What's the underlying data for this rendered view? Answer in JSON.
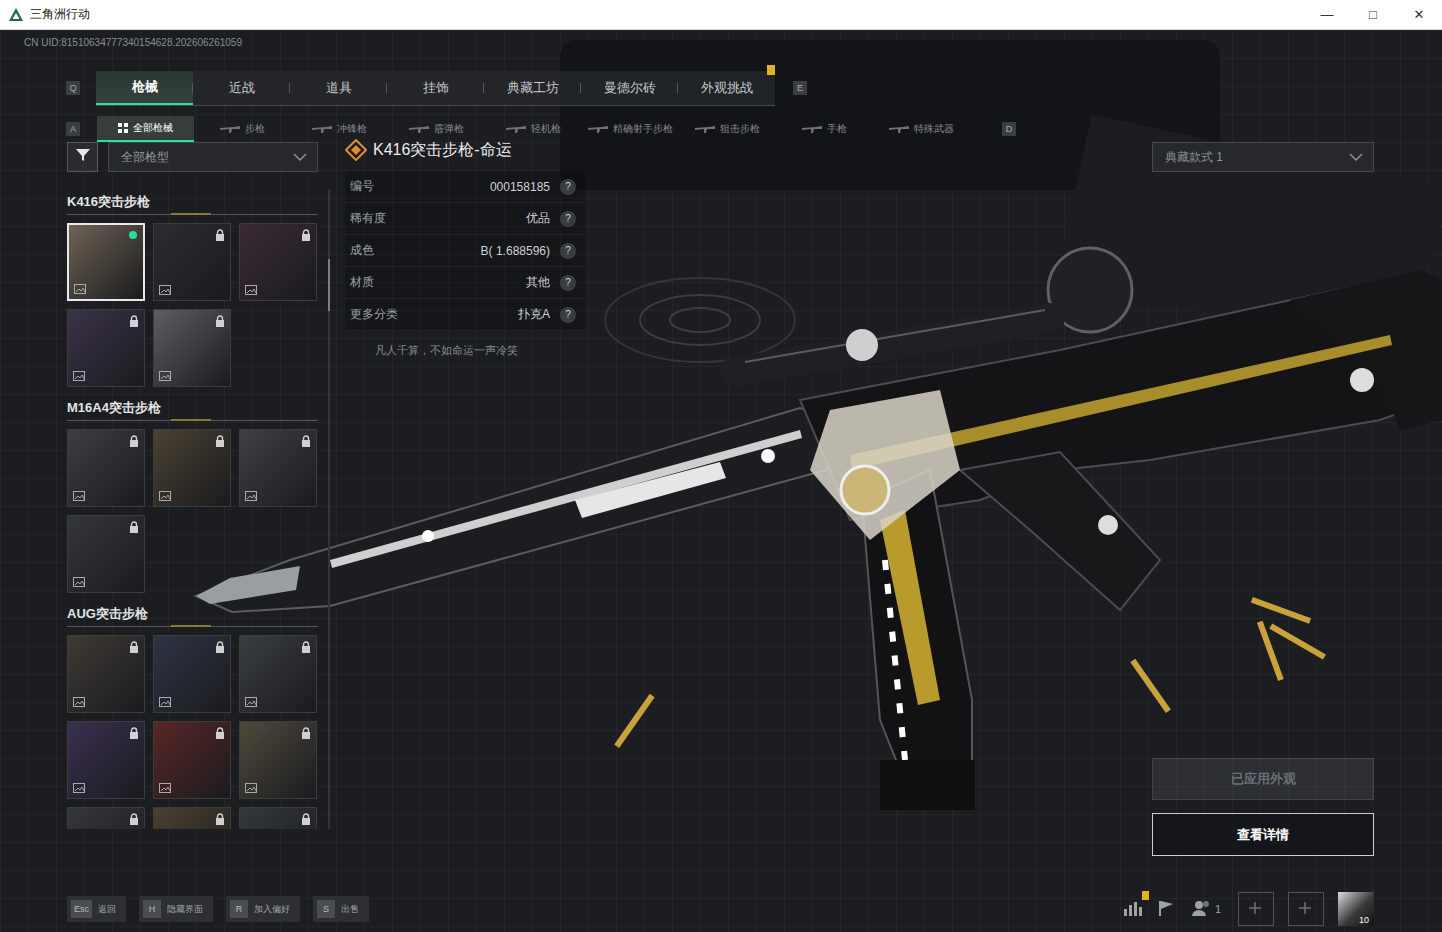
{
  "window": {
    "title": "三角洲行动",
    "controls": [
      "—",
      "□",
      "✕"
    ]
  },
  "uid": "CN UID:81510634777340154628.202606261059",
  "top_tabs": {
    "prev_key": "Q",
    "next_key": "E",
    "items": [
      {
        "label": "枪械",
        "selected": true,
        "badge": false
      },
      {
        "label": "近战",
        "selected": false,
        "badge": false
      },
      {
        "label": "道具",
        "selected": false,
        "badge": false
      },
      {
        "label": "挂饰",
        "selected": false,
        "badge": false
      },
      {
        "label": "典藏工坊",
        "selected": false,
        "badge": false
      },
      {
        "label": "曼德尔砖",
        "selected": false,
        "badge": false
      },
      {
        "label": "外观挑战",
        "selected": false,
        "badge": true
      }
    ]
  },
  "sub_tabs": {
    "prev_key": "A",
    "next_key": "D",
    "items": [
      {
        "label": "全部枪械",
        "selected": true,
        "kind": "all"
      },
      {
        "label": "步枪",
        "selected": false,
        "kind": "weapon"
      },
      {
        "label": "冲锋枪",
        "selected": false,
        "kind": "weapon"
      },
      {
        "label": "霰弹枪",
        "selected": false,
        "kind": "weapon"
      },
      {
        "label": "轻机枪",
        "selected": false,
        "kind": "weapon"
      },
      {
        "label": "精确射手步枪",
        "selected": false,
        "kind": "weapon"
      },
      {
        "label": "狙击步枪",
        "selected": false,
        "kind": "weapon"
      },
      {
        "label": "手枪",
        "selected": false,
        "kind": "weapon"
      },
      {
        "label": "特殊武器",
        "selected": false,
        "kind": "weapon"
      }
    ]
  },
  "filter": {
    "value": "全部枪型"
  },
  "groups": [
    {
      "title": "K416突击步枪",
      "items": [
        {
          "selected": true,
          "locked": false,
          "equipped": true,
          "color": "#6e6254"
        },
        {
          "selected": false,
          "locked": true,
          "equipped": false,
          "color": "#2c2c30"
        },
        {
          "selected": false,
          "locked": true,
          "equipped": false,
          "color": "#3a2a34"
        },
        {
          "selected": false,
          "locked": true,
          "equipped": false,
          "color": "#3b3248"
        },
        {
          "selected": false,
          "locked": true,
          "equipped": false,
          "color": "#5c5e60"
        }
      ]
    },
    {
      "title": "M16A4突击步枪",
      "items": [
        {
          "selected": false,
          "locked": true,
          "equipped": false,
          "color": "#3c3e42"
        },
        {
          "selected": false,
          "locked": true,
          "equipped": false,
          "color": "#4a4232"
        },
        {
          "selected": false,
          "locked": true,
          "equipped": false,
          "color": "#3e4042"
        },
        {
          "selected": false,
          "locked": true,
          "equipped": false,
          "color": "#34373a"
        }
      ]
    },
    {
      "title": "AUG突击步枪",
      "items": [
        {
          "selected": false,
          "locked": true,
          "equipped": false,
          "color": "#3e3a34"
        },
        {
          "selected": false,
          "locked": true,
          "equipped": false,
          "color": "#2e3444"
        },
        {
          "selected": false,
          "locked": true,
          "equipped": false,
          "color": "#3a3e40"
        },
        {
          "selected": false,
          "locked": true,
          "equipped": false,
          "color": "#3a3050"
        },
        {
          "selected": false,
          "locked": true,
          "equipped": false,
          "color": "#5a2626"
        },
        {
          "selected": false,
          "locked": true,
          "equipped": false,
          "color": "#4e4a3c"
        },
        {
          "selected": false,
          "locked": true,
          "equipped": false,
          "color": "#33363c"
        },
        {
          "selected": false,
          "locked": true,
          "equipped": false,
          "color": "#4a4030"
        },
        {
          "selected": false,
          "locked": true,
          "equipped": false,
          "color": "#34383a"
        }
      ]
    }
  ],
  "detail": {
    "title": "K416突击步枪-命运",
    "rows": [
      {
        "label": "编号",
        "value": "000158185",
        "help": "?"
      },
      {
        "label": "稀有度",
        "value": "优品",
        "help": "?"
      },
      {
        "label": "成色",
        "value": "B( 1.688596)",
        "help": "?"
      },
      {
        "label": "材质",
        "value": "其他",
        "help": "?"
      },
      {
        "label": "更多分类",
        "value": "扑克A",
        "help": "?"
      }
    ],
    "quote": "凡人千算，不如命运一声冷笑"
  },
  "style_select": {
    "value": "典藏款式 1"
  },
  "buttons": [
    {
      "label": "已应用外观",
      "disabled": true
    },
    {
      "label": "查看详情",
      "disabled": false
    }
  ],
  "hotkeys": [
    {
      "key": "Esc",
      "label": "返回"
    },
    {
      "key": "H",
      "label": "隐藏界面"
    },
    {
      "key": "R",
      "label": "加入偏好"
    },
    {
      "key": "S",
      "label": "出售"
    }
  ],
  "status_icons": [
    {
      "kind": "stats",
      "badge": true,
      "count": ""
    },
    {
      "kind": "flag",
      "badge": false,
      "count": ""
    },
    {
      "kind": "friends",
      "badge": false,
      "count": "1"
    },
    {
      "kind": "add",
      "badge": false,
      "count": ""
    },
    {
      "kind": "add",
      "badge": false,
      "count": ""
    },
    {
      "kind": "avatar",
      "badge": false,
      "count": "10"
    }
  ]
}
